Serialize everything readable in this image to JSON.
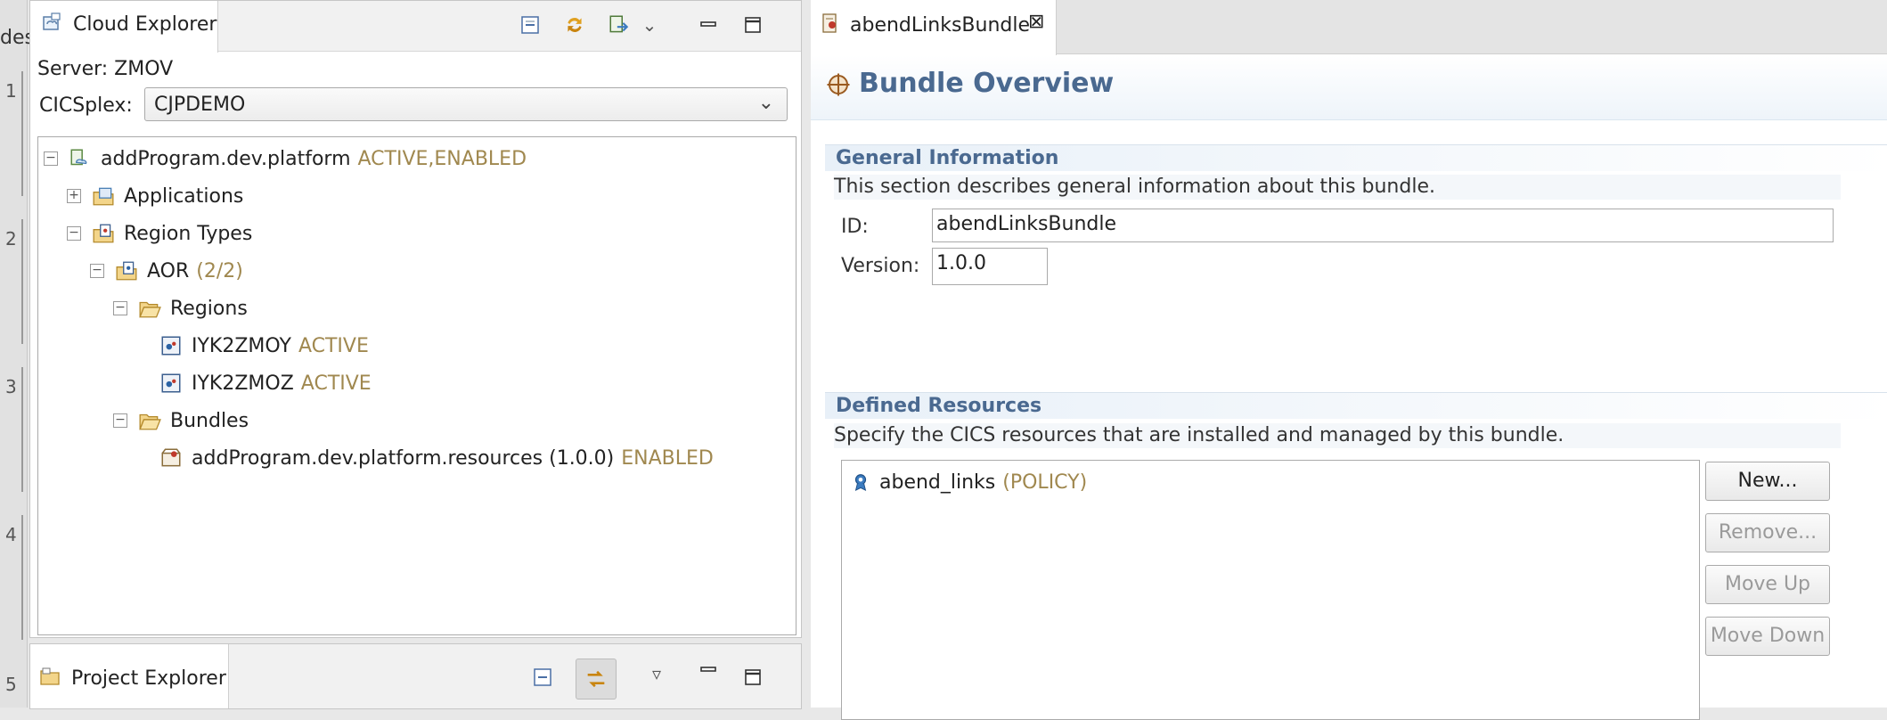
{
  "left_strip": {
    "fragment": "des",
    "numbers": [
      "1",
      "2",
      "3",
      "4",
      "5"
    ]
  },
  "cloud_explorer": {
    "tab_label": "Cloud Explorer",
    "server_label": "Server: ZMOV",
    "cicsplex_label": "CICSplex:",
    "cicsplex_value": "CJPDEMO",
    "tree": [
      {
        "label": "addProgram.dev.platform",
        "status": "ACTIVE,ENABLED",
        "expander": "−",
        "icon": "platform-icon",
        "level": 0
      },
      {
        "label": "Applications",
        "status": "",
        "expander": "+",
        "icon": "applications-folder-icon",
        "level": 1
      },
      {
        "label": "Region Types",
        "status": "",
        "expander": "−",
        "icon": "region-types-folder-icon",
        "level": 1
      },
      {
        "label": "AOR",
        "status": "(2/2)",
        "expander": "−",
        "icon": "region-type-icon",
        "level": 2
      },
      {
        "label": "Regions",
        "status": "",
        "expander": "−",
        "icon": "folder-open-icon",
        "level": 3
      },
      {
        "label": "IYK2ZMOY",
        "status": "ACTIVE",
        "expander": "",
        "icon": "region-icon",
        "level": 4
      },
      {
        "label": "IYK2ZMOZ",
        "status": "ACTIVE",
        "expander": "",
        "icon": "region-icon",
        "level": 4
      },
      {
        "label": "Bundles",
        "status": "",
        "expander": "−",
        "icon": "folder-open-icon",
        "level": 3
      },
      {
        "label": "addProgram.dev.platform.resources (1.0.0)",
        "status": "ENABLED",
        "expander": "",
        "icon": "bundle-icon",
        "level": 4
      }
    ]
  },
  "project_explorer": {
    "tab_label": "Project Explorer"
  },
  "editor": {
    "tab_label": "abendLinksBundle",
    "title": "Bundle Overview",
    "general": {
      "title": "General Information",
      "description": "This section describes general information about this bundle.",
      "id_label": "ID:",
      "id_value": "abendLinksBundle",
      "version_label": "Version:",
      "version_value": "1.0.0"
    },
    "resources": {
      "title": "Defined Resources",
      "description": "Specify the CICS resources that are installed and managed by this bundle.",
      "items": [
        {
          "name": "abend_links",
          "type": "(POLICY)"
        }
      ],
      "buttons": {
        "new": "New...",
        "remove": "Remove...",
        "move_up": "Move Up",
        "move_down": "Move Down"
      }
    }
  },
  "colors": {
    "status": "#a0884f",
    "section_title": "#4a6990"
  }
}
